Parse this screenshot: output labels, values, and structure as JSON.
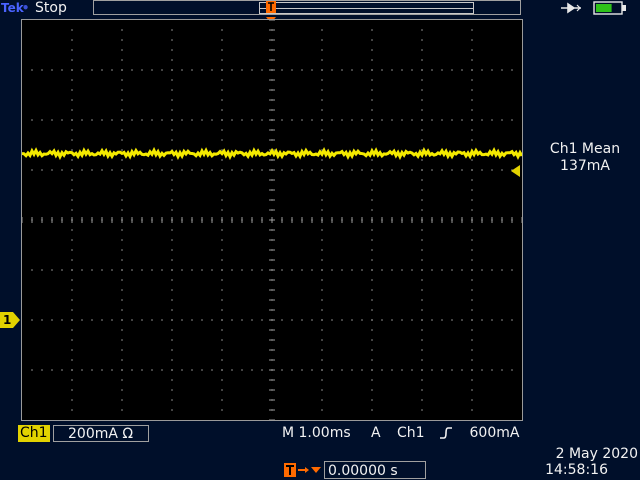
{
  "header": {
    "brand_tek": "Tek",
    "brand_sep": "•",
    "run_status": "Stop"
  },
  "measurement": {
    "label": "Ch1 Mean",
    "value": "137mA"
  },
  "channel": {
    "marker": "1",
    "label": "Ch1",
    "scale": "200mA",
    "coupling_icon": "ohm-icon",
    "coupling_symbol": "Ω",
    "color": "#f4ea00"
  },
  "horizontal": {
    "timebase": "M 1.00ms",
    "position": "0.00000 s"
  },
  "trigger": {
    "mode": "A",
    "source": "Ch1",
    "slope_icon": "rising-edge-icon",
    "level": "600mA",
    "marker": "T",
    "color": "#ff6a00"
  },
  "datetime": {
    "date": "2 May 2020",
    "time": "14:58:16"
  },
  "waveform": {
    "level_div": 1.33,
    "noise_div": 0.04
  },
  "status": {
    "battery_level": 0.65
  }
}
